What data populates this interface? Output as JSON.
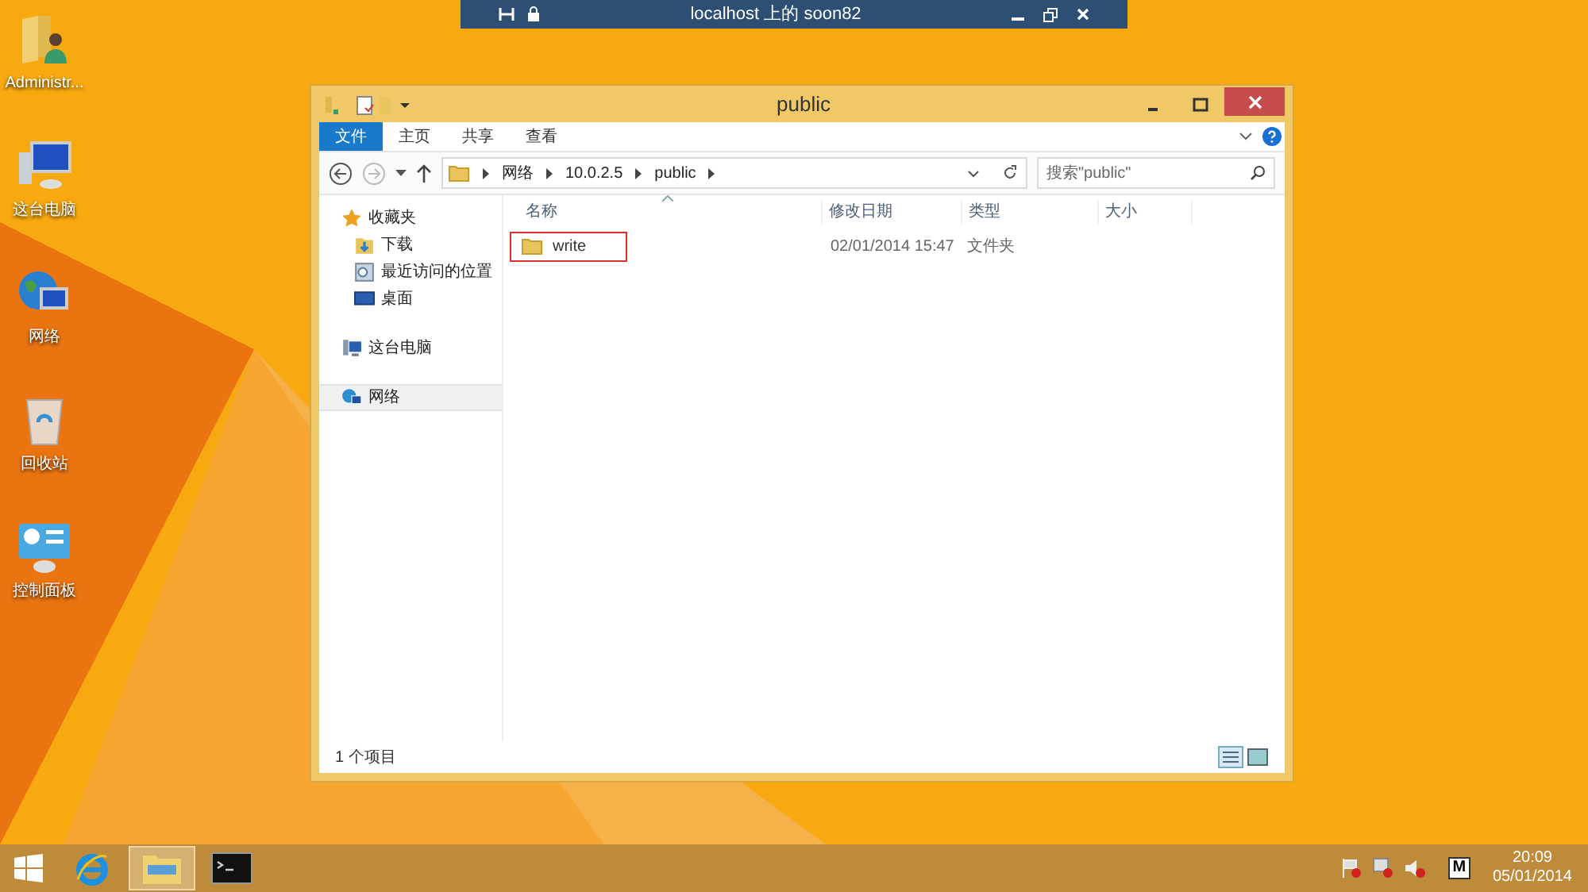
{
  "remote_bar": {
    "title": "localhost 上的 soon82"
  },
  "desktop_icons": [
    {
      "label": "Administr...",
      "kind": "user"
    },
    {
      "label": "这台电脑",
      "kind": "computer"
    },
    {
      "label": "网络",
      "kind": "network"
    },
    {
      "label": "回收站",
      "kind": "recycle"
    },
    {
      "label": "控制面板",
      "kind": "control"
    }
  ],
  "window": {
    "title": "public",
    "ribbon_tabs": [
      {
        "label": "文件",
        "selected": true
      },
      {
        "label": "主页",
        "selected": false
      },
      {
        "label": "共享",
        "selected": false
      },
      {
        "label": "查看",
        "selected": false
      }
    ],
    "breadcrumb": [
      "网络",
      "10.0.2.5",
      "public"
    ],
    "search": {
      "placeholder": "搜索\"public\""
    },
    "sidebar": {
      "items": [
        {
          "label": "收藏夹",
          "kind": "star",
          "selected": false,
          "children": [
            {
              "label": "下载",
              "kind": "download",
              "selected": false
            },
            {
              "label": "最近访问的位置",
              "kind": "recent",
              "selected": false
            },
            {
              "label": "桌面",
              "kind": "desktop",
              "selected": false
            }
          ]
        },
        {
          "label": "这台电脑",
          "kind": "computer",
          "selected": false
        },
        {
          "label": "网络",
          "kind": "network",
          "selected": true
        }
      ]
    },
    "table": {
      "columns": [
        "名称",
        "修改日期",
        "类型",
        "大小"
      ],
      "rows": [
        {
          "name": "write",
          "modified": "02/01/2014 15:47",
          "type": "文件夹",
          "highlighted": true
        }
      ]
    },
    "status_bar": "1 个项目"
  },
  "taskbar": {
    "apps": [
      {
        "kind": "ie",
        "active": false
      },
      {
        "kind": "explorer",
        "active": true
      },
      {
        "kind": "cmd",
        "active": false
      }
    ],
    "tray_label": "M",
    "time": "20:09",
    "date": "05/01/2014"
  }
}
